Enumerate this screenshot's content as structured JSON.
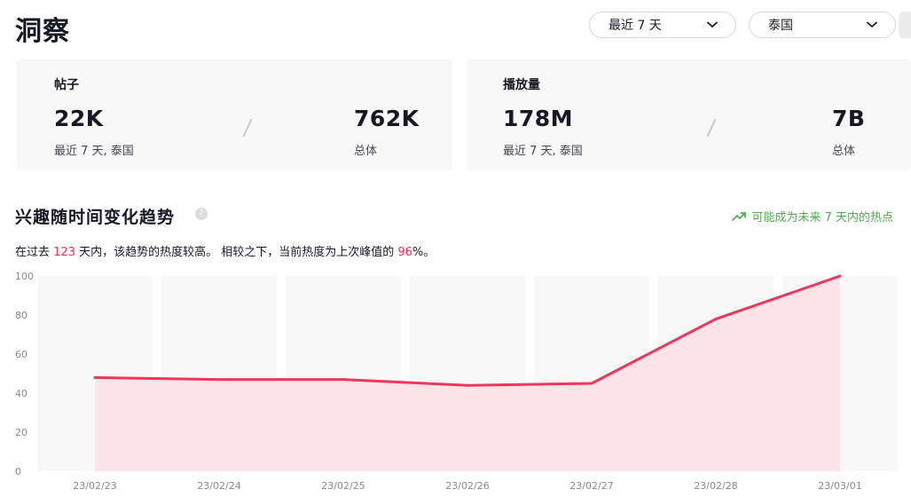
{
  "header": {
    "title": "洞察",
    "period_select": "最近 7 天",
    "region_select": "泰国"
  },
  "stats": {
    "posts": {
      "label": "帖子",
      "recent_value": "22K",
      "recent_caption": "最近 7 天, 泰国",
      "total_value": "762K",
      "total_caption": "总体"
    },
    "views": {
      "label": "播放量",
      "recent_value": "178M",
      "recent_caption": "最近 7 天, 泰国",
      "total_value": "7B",
      "total_caption": "总体"
    }
  },
  "trend": {
    "title": "兴趣随时间变化趋势",
    "prediction": "可能成为未来 7 天内的热点",
    "summary_prefix": "在过去 ",
    "summary_days": "123",
    "summary_mid": " 天内，该趋势的热度较高。 相较之下，当前热度为上次峰值的 ",
    "summary_pct": "96",
    "summary_suffix": "%。"
  },
  "colors": {
    "accent": "#fe2c55",
    "line": "#f0365a",
    "fill": "#fde4e8",
    "positive": "#4cae4c"
  },
  "chart_data": {
    "type": "area",
    "x": [
      "23/02/23",
      "23/02/24",
      "23/02/25",
      "23/02/26",
      "23/02/27",
      "23/02/28",
      "23/03/01"
    ],
    "values": [
      48,
      47,
      47,
      44,
      45,
      78,
      100
    ],
    "y_ticks": [
      0,
      20,
      40,
      60,
      80,
      100
    ],
    "ylim": [
      0,
      100
    ],
    "grid": false
  }
}
